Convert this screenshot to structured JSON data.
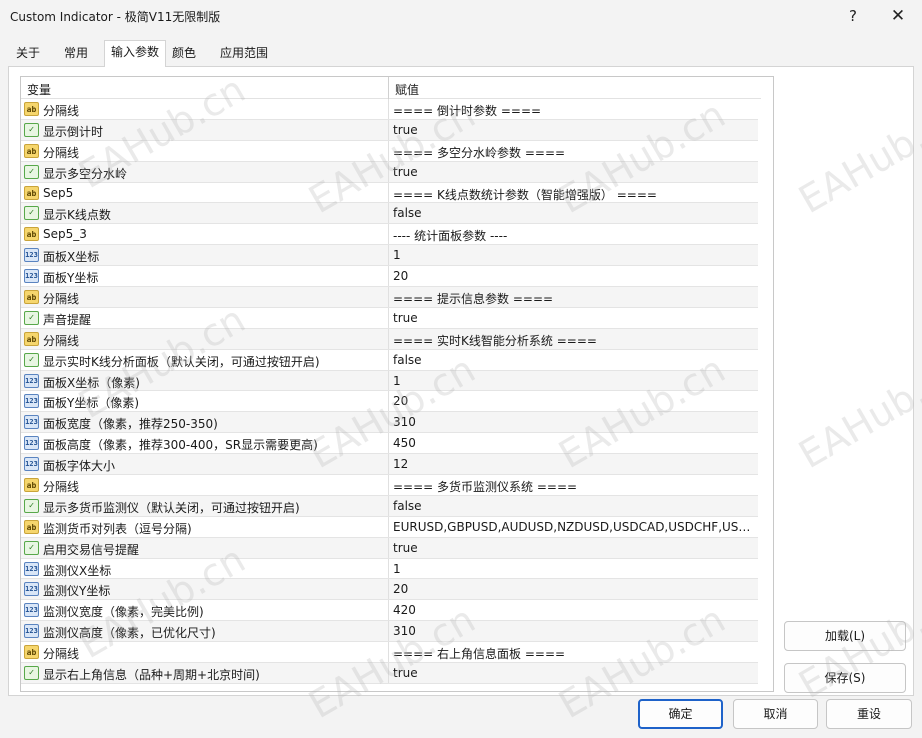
{
  "window": {
    "title": "Custom Indicator - 极简V11无限制版",
    "help_label": "?",
    "close_label": "✕"
  },
  "tabs": [
    {
      "label": "关于"
    },
    {
      "label": "常用"
    },
    {
      "label": "输入参数"
    },
    {
      "label": "颜色"
    },
    {
      "label": "应用范围"
    }
  ],
  "grid": {
    "col_variable": "变量",
    "col_value": "赋值",
    "rows": [
      {
        "type": "ab",
        "name": "分隔线",
        "value": "==== 倒计时参数 ===="
      },
      {
        "type": "bool",
        "name": "显示倒计时",
        "value": "true"
      },
      {
        "type": "ab",
        "name": "分隔线",
        "value": "==== 多空分水岭参数 ===="
      },
      {
        "type": "bool",
        "name": "显示多空分水岭",
        "value": "true"
      },
      {
        "type": "ab",
        "name": "Sep5",
        "value": "==== K线点数统计参数（智能增强版） ===="
      },
      {
        "type": "bool",
        "name": "显示K线点数",
        "value": "false"
      },
      {
        "type": "ab",
        "name": "Sep5_3",
        "value": "---- 统计面板参数 ----"
      },
      {
        "type": "int",
        "name": "面板X坐标",
        "value": "1"
      },
      {
        "type": "int",
        "name": "面板Y坐标",
        "value": "20"
      },
      {
        "type": "ab",
        "name": "分隔线",
        "value": "==== 提示信息参数 ===="
      },
      {
        "type": "bool",
        "name": "声音提醒",
        "value": "true"
      },
      {
        "type": "ab",
        "name": "分隔线",
        "value": "==== 实时K线智能分析系统 ===="
      },
      {
        "type": "bool",
        "name": "显示实时K线分析面板（默认关闭，可通过按钮开启)",
        "value": "false"
      },
      {
        "type": "int",
        "name": "面板X坐标（像素)",
        "value": "1"
      },
      {
        "type": "int",
        "name": "面板Y坐标（像素)",
        "value": "20"
      },
      {
        "type": "int",
        "name": "面板宽度（像素，推荐250-350)",
        "value": "310"
      },
      {
        "type": "int",
        "name": "面板高度（像素，推荐300-400，SR显示需要更高)",
        "value": "450"
      },
      {
        "type": "int",
        "name": "面板字体大小",
        "value": "12"
      },
      {
        "type": "ab",
        "name": "分隔线",
        "value": "==== 多货币监测仪系统 ===="
      },
      {
        "type": "bool",
        "name": "显示多货币监测仪（默认关闭，可通过按钮开启)",
        "value": "false"
      },
      {
        "type": "ab",
        "name": "监测货币对列表（逗号分隔)",
        "value": "EURUSD,GBPUSD,AUDUSD,NZDUSD,USDCAD,USDCHF,USDJPY"
      },
      {
        "type": "bool",
        "name": "启用交易信号提醒",
        "value": "true"
      },
      {
        "type": "int",
        "name": "监测仪X坐标",
        "value": "1"
      },
      {
        "type": "int",
        "name": "监测仪Y坐标",
        "value": "20"
      },
      {
        "type": "int",
        "name": "监测仪宽度（像素，完美比例)",
        "value": "420"
      },
      {
        "type": "int",
        "name": "监测仪高度（像素，已优化尺寸)",
        "value": "310"
      },
      {
        "type": "ab",
        "name": "分隔线",
        "value": "==== 右上角信息面板 ===="
      },
      {
        "type": "bool",
        "name": "显示右上角信息（品种+周期+北京时间)",
        "value": "true"
      }
    ]
  },
  "icons": {
    "ab": {
      "text": "ab",
      "name": "string-type-icon"
    },
    "bool": {
      "text": "✓",
      "name": "bool-type-icon"
    },
    "int": {
      "text": "123",
      "name": "int-type-icon"
    }
  },
  "buttons": {
    "load": "加载(L)",
    "save": "保存(S)",
    "ok": "确定",
    "cancel": "取消",
    "reset": "重设"
  },
  "watermark_text": "EAHub.cn",
  "colors": {
    "ok_border": "#1e62c9"
  }
}
